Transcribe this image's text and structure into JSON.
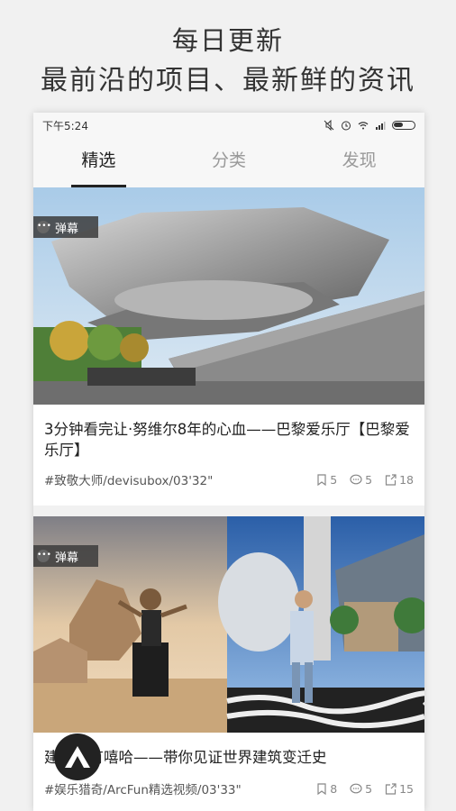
{
  "promo": {
    "line1": "每日更新",
    "line2": "最前沿的项目、最新鲜的资讯"
  },
  "statusbar": {
    "time": "下午5:24"
  },
  "tabs": [
    {
      "label": "精选",
      "active": true
    },
    {
      "label": "分类",
      "active": false
    },
    {
      "label": "发现",
      "active": false
    }
  ],
  "cards": [
    {
      "danmu": "弹幕",
      "title": "3分钟看完让·努维尔8年的心血——巴黎爱乐厅【巴黎爱乐厅】",
      "tag": "#致敬大师/devisubox/03'32\"",
      "bookmarks": "5",
      "comments": "5",
      "shares": "18"
    },
    {
      "danmu": "弹幕",
      "title": "建筑也有嘻哈——带你见证世界建筑变迁史",
      "tag": "#娱乐猎奇/ArcFun精选视频/03'33\"",
      "bookmarks": "8",
      "comments": "5",
      "shares": "15"
    }
  ]
}
